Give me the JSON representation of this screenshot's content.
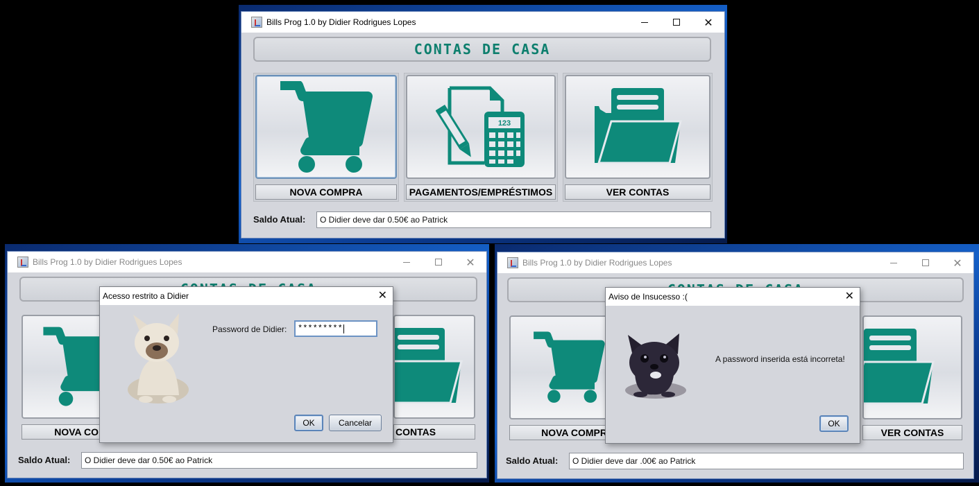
{
  "colors": {
    "accent": "#0e8a7a",
    "window_bg": "#d4d6dc",
    "titlebar_bg": "#ffffff"
  },
  "app": {
    "window_title": "Bills Prog 1.0 by Didier Rodrigues Lopes",
    "banner": "CONTAS DE CASA",
    "buttons": {
      "nova_compra": "NOVA COMPRA",
      "pagamentos": "PAGAMENTOS/EMPRÉSTIMOS",
      "ver_contas": "VER CONTAS"
    },
    "saldo_label": "Saldo Atual:"
  },
  "screens": {
    "main": {
      "saldo_value": "O Didier deve dar 0.50€ ao Patrick"
    },
    "login": {
      "saldo_value": "O Didier deve dar 0.50€ ao Patrick",
      "nova_compra_visible": "NOVA CO",
      "ver_contas_visible": "CONTAS",
      "dialog_title": "Acesso restrito a Didier",
      "password_label": "Password de Didier:",
      "password_value": "*********",
      "ok_label": "OK",
      "cancel_label": "Cancelar"
    },
    "error": {
      "saldo_value": "O Didier deve dar .00€ ao Patrick",
      "nova_compra_visible": "NOVA COMPR",
      "ver_contas_visible": "VER CONTAS",
      "dialog_title": "Aviso de Insucesso :(",
      "message": "A password inserida está incorreta!",
      "ok_label": "OK"
    }
  },
  "icons": [
    "cart-icon",
    "document-calculator-icon",
    "folder-icon",
    "dog-photo-icon",
    "sad-dog-photo-icon",
    "java-app-icon",
    "minimize-icon",
    "maximize-icon",
    "close-icon"
  ]
}
